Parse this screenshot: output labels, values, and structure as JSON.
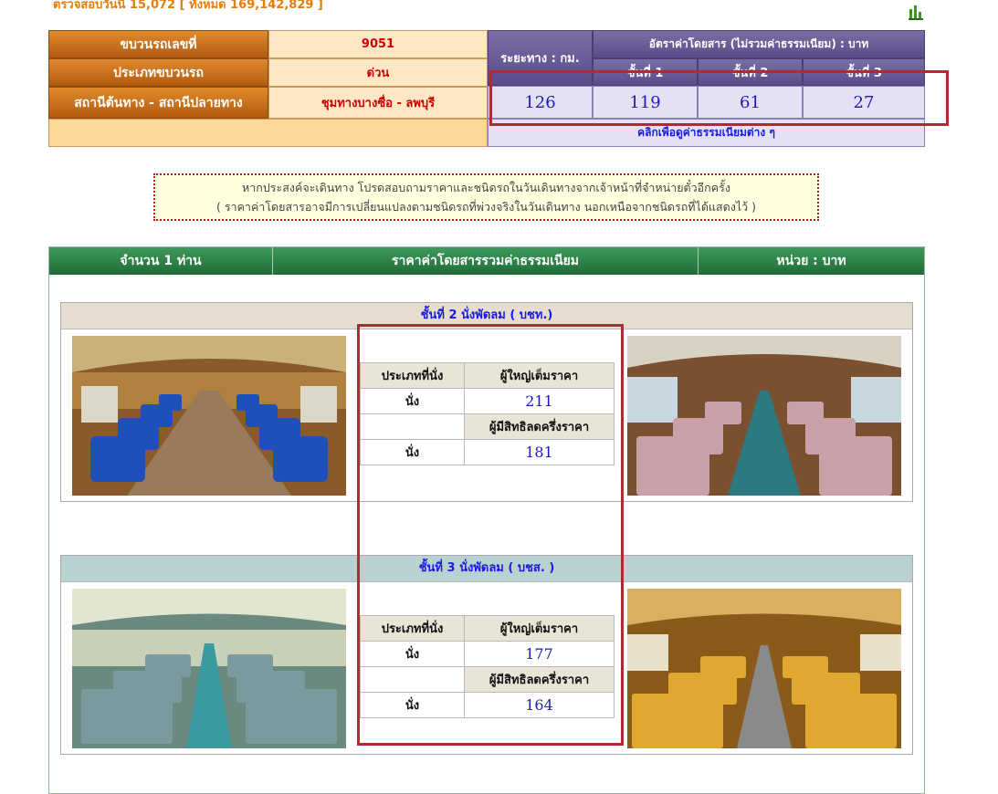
{
  "header": {
    "visit_counter": "ตรวจสอบวันนี้ 15,072 [ ทั้งหมด 169,142,829 ]",
    "stats_icon": "bar-chart-icon"
  },
  "train": {
    "number_label": "ขบวนรถเลขที่",
    "number_value": "9051",
    "type_label": "ประเภทขบวนรถ",
    "type_value": "ด่วน",
    "route_label": "สถานีต้นทาง - สถานีปลายทาง",
    "route_value": "ชุมทางบางซื่อ - ลพบุรี"
  },
  "fare_summary": {
    "distance_label": "ระยะทาง : กม.",
    "fare_header": "อัตราค่าโดยสาร (ไม่รวมค่าธรรมเนียม) : บาท",
    "class_headers": [
      "ชั้นที่ 1",
      "ชั้นที่ 2",
      "ชั้นที่ 3"
    ],
    "distance_value": "126",
    "class_values": [
      "119",
      "61",
      "27"
    ],
    "fee_link": "คลิกเพื่อดูค่าธรรมเนียมต่าง ๆ"
  },
  "notice": {
    "line1": "หากประสงค์จะเดินทาง โปรดสอบถามราคาและชนิดรถในวันเดินทางจากเจ้าหน้าที่จำหน่ายตั๋วอีกครั้ง",
    "line2": "( ราคาค่าโดยสารอาจมีการเปลี่ยนแปลงตามชนิดรถที่พ่วงจริงในวันเดินทาง นอกเหนือจากชนิดรถที่ได้แสดงไว้ )"
  },
  "fare_panel": {
    "col_passengers": "จำนวน 1 ท่าน",
    "col_price": "ราคาค่าโดยสารรวมค่าธรรมเนียม",
    "col_unit": "หน่วย : บาท"
  },
  "classes": [
    {
      "title": "ชั้นที่ 2 นั่งพัดลม ( บชท.)",
      "seat_type_header": "ประเภทที่นั่ง",
      "adult_header": "ผู้ใหญ่เต็มราคา",
      "adult_seat": "นั่ง",
      "adult_price": "211",
      "half_header": "ผู้มีสิทธิลดครึ่งราคา",
      "half_seat": "นั่ง",
      "half_price": "181",
      "title_bg": "#e6ddd0"
    },
    {
      "title": "ชั้นที่ 3 นั่งพัดลม ( บชส. )",
      "seat_type_header": "ประเภทที่นั่ง",
      "adult_header": "ผู้ใหญ่เต็มราคา",
      "adult_seat": "นั่ง",
      "adult_price": "177",
      "half_header": "ผู้มีสิทธิลดครึ่งราคา",
      "half_seat": "นั่ง",
      "half_price": "164",
      "title_bg": "#b8d2d2"
    }
  ],
  "colors": {
    "highlight": "#b02a32",
    "orange_header": "#c8701c",
    "purple_header": "#6a5c96",
    "green_header": "#2e8048"
  }
}
